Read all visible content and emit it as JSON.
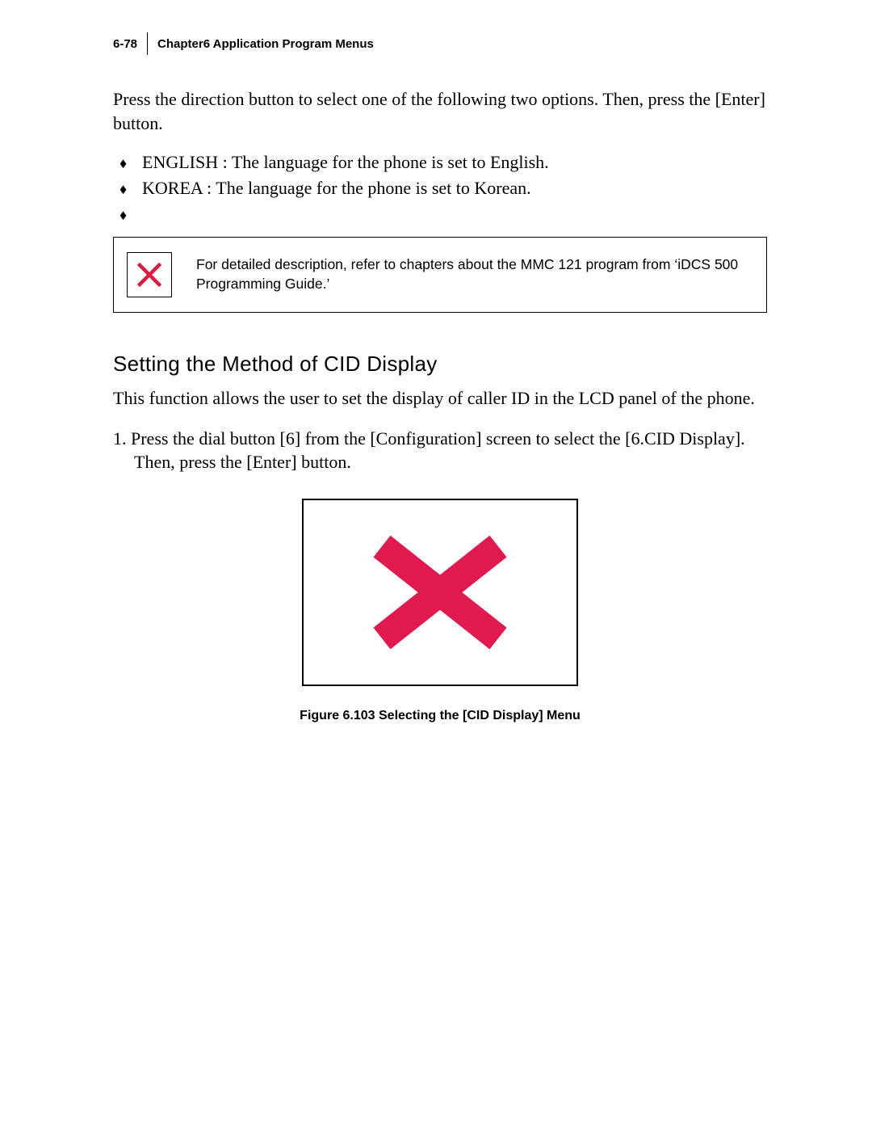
{
  "header": {
    "page_number": "6-78",
    "chapter_label": "Chapter6  Application Program Menus"
  },
  "intro_paragraph": "Press the direction button to select one of the following two options. Then, press the [Enter] button.",
  "bullets": {
    "item1": "ENGLISH : The language for the phone is set to English.",
    "item2": "KOREA : The language for the phone is set to Korean.",
    "item3": ""
  },
  "note": {
    "text": "For detailed description, refer to chapters about the MMC 121 program from ‘iDCS 500 Programming Guide.’"
  },
  "section": {
    "title": "Setting the Method of CID Display",
    "intro": "This function allows the user to set the display of caller ID in the LCD panel of the phone.",
    "step1": "1.  Press the dial button [6] from the [Configuration] screen to select the [6.CID Display]. Then, press the [Enter] button."
  },
  "figure": {
    "caption": "Figure 6.103 Selecting the [CID Display] Menu"
  }
}
